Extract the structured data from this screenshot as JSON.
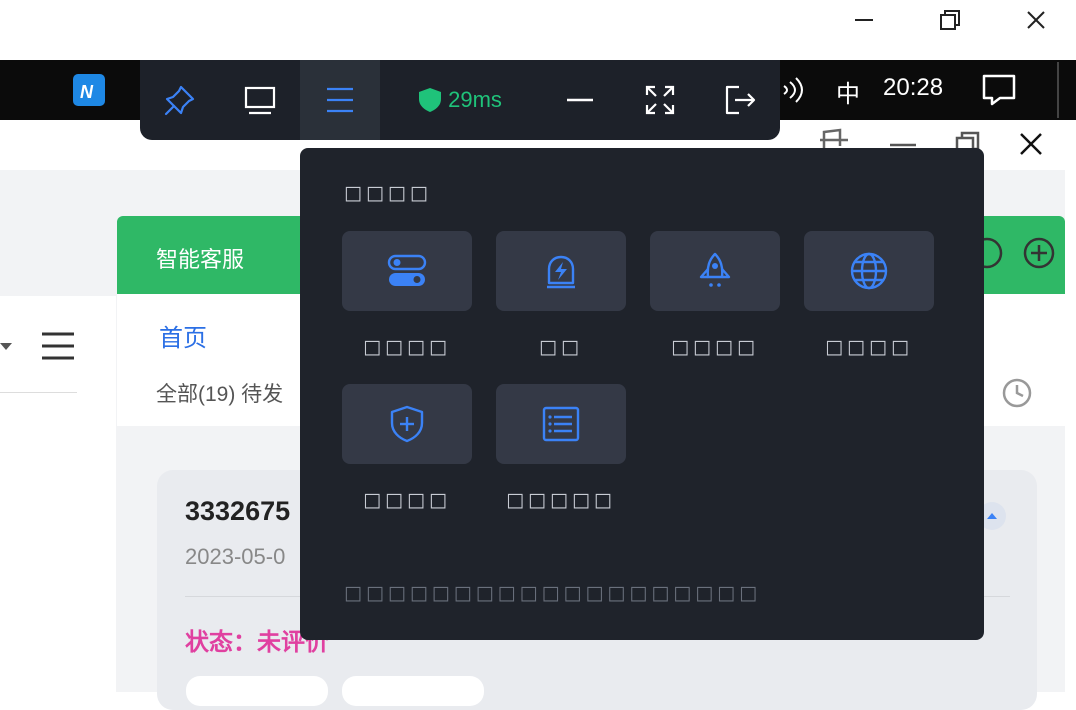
{
  "taskbar": {
    "ime": "中",
    "time": "20:28"
  },
  "toolbar": {
    "ping": "29ms"
  },
  "app": {
    "tab_label": "智能客服",
    "home_tab": "首页",
    "filter_text": "全部(19) 待发",
    "card_id": "3332675",
    "card_date": "2023-05-0",
    "card_status": "状态：未评价"
  },
  "panel": {
    "title": "□□□□",
    "items": [
      {
        "label": "□□□□",
        "icon": "toggle-icon"
      },
      {
        "label": "□□",
        "icon": "lightning-icon"
      },
      {
        "label": "□□□□",
        "icon": "rocket-icon"
      },
      {
        "label": "□□□□",
        "icon": "globe-icon"
      },
      {
        "label": "□□□□",
        "icon": "shield-plus-icon"
      },
      {
        "label": "□□□□□",
        "icon": "list-icon"
      }
    ],
    "footer": "□□□□□□□□□□□□□□□□□□□"
  },
  "colors": {
    "accent": "#3b82f6",
    "ping_green": "#1fc37a",
    "brand_green": "#2fb866",
    "panel_bg": "#1f232b"
  }
}
